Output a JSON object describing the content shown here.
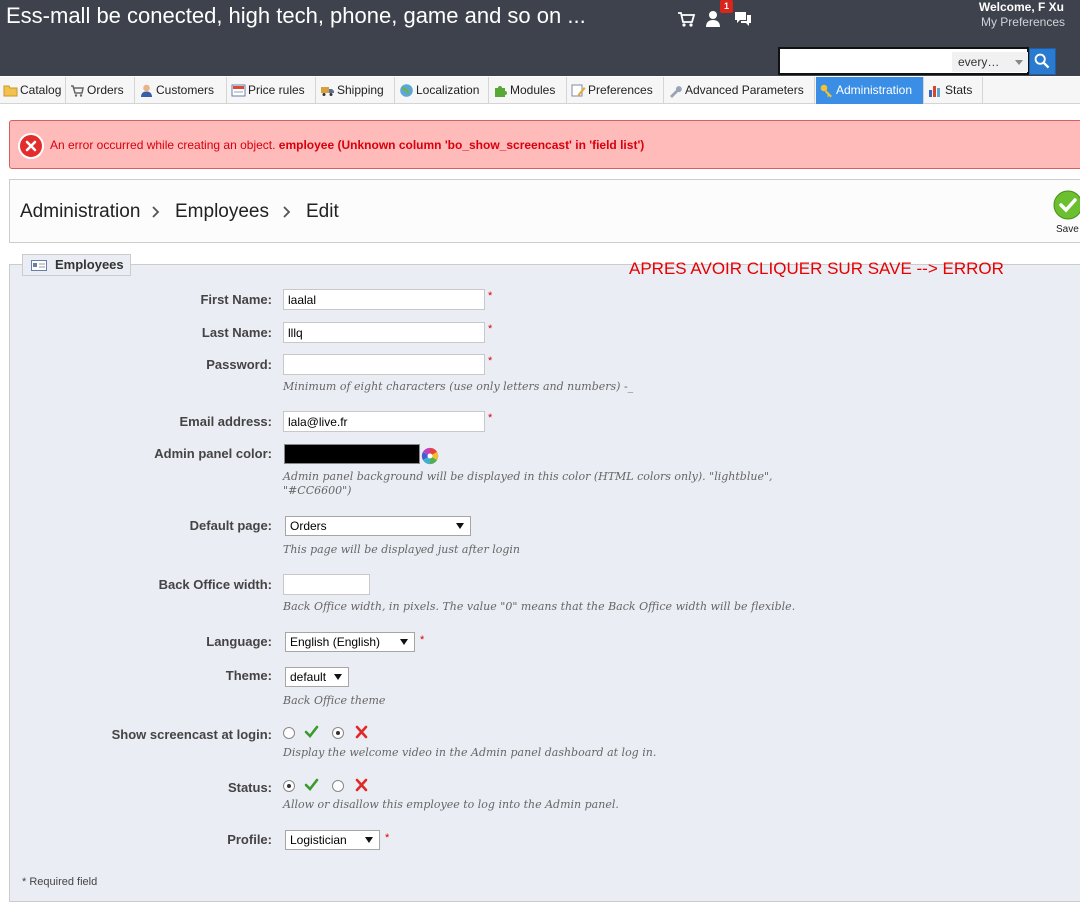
{
  "header": {
    "shop_title": "Ess-mall be conected, high tech, phone, game and so on ...",
    "notification_count": "1",
    "welcome": "Welcome, F Xu",
    "preferences_link": "My Preferences",
    "search": {
      "value": "",
      "scope": "every…"
    }
  },
  "menu": {
    "items": [
      {
        "label": "Catalog",
        "icon": "folder-icon"
      },
      {
        "label": "Orders",
        "icon": "cart-icon"
      },
      {
        "label": "Customers",
        "icon": "customer-icon"
      },
      {
        "label": "Price rules",
        "icon": "price-rules-icon"
      },
      {
        "label": "Shipping",
        "icon": "truck-icon"
      },
      {
        "label": "Localization",
        "icon": "globe-icon"
      },
      {
        "label": "Modules",
        "icon": "puzzle-icon"
      },
      {
        "label": "Preferences",
        "icon": "preferences-icon"
      },
      {
        "label": "Advanced Parameters",
        "icon": "wrench-icon"
      },
      {
        "label": "Administration",
        "icon": "key-icon",
        "active": true
      },
      {
        "label": "Stats",
        "icon": "bar-chart-icon"
      }
    ],
    "active_color": "#3a8ee6"
  },
  "error": {
    "message": "An error occurred while creating an object.",
    "detail": "employee (Unknown column 'bo_show_screencast' in 'field list')",
    "color": "#d8000c"
  },
  "breadcrumb": {
    "items": [
      "Administration",
      "Employees",
      "Edit"
    ]
  },
  "toolbar": {
    "save_label": "Save"
  },
  "form": {
    "legend": "Employees",
    "annotation": "APRES AVOIR CLIQUER SUR SAVE --> ERROR",
    "required_mark": "*",
    "first_name": {
      "label": "First Name:",
      "value": "laalal"
    },
    "last_name": {
      "label": "Last Name:",
      "value": "lllq"
    },
    "password": {
      "label": "Password:",
      "value": "",
      "hint": "Minimum of eight characters (use only letters and numbers) -_"
    },
    "email": {
      "label": "Email address:",
      "value": "lala@live.fr"
    },
    "admin_color": {
      "label": "Admin panel color:",
      "value_color": "#000000",
      "hint_line1": "Admin panel background will be displayed in this color (HTML colors only). \"lightblue\",",
      "hint_line2": "\"#CC6600\")"
    },
    "default_page": {
      "label": "Default page:",
      "selected": "Orders",
      "hint": "This page will be displayed just after login"
    },
    "bo_width": {
      "label": "Back Office width:",
      "value": "",
      "hint": "Back Office width, in pixels. The value \"0\" means that the Back Office width will be flexible."
    },
    "language": {
      "label": "Language:",
      "selected": "English (English)"
    },
    "theme": {
      "label": "Theme:",
      "selected": "default",
      "hint": "Back Office theme"
    },
    "screencast": {
      "label": "Show screencast at login:",
      "yes_checked": false,
      "no_checked": true,
      "hint": "Display the welcome video in the Admin panel dashboard at log in."
    },
    "status": {
      "label": "Status:",
      "yes_checked": true,
      "no_checked": false,
      "hint": "Allow or disallow this employee to log into the Admin panel."
    },
    "profile": {
      "label": "Profile:",
      "selected": "Logistician"
    },
    "required_note": "* Required field"
  }
}
